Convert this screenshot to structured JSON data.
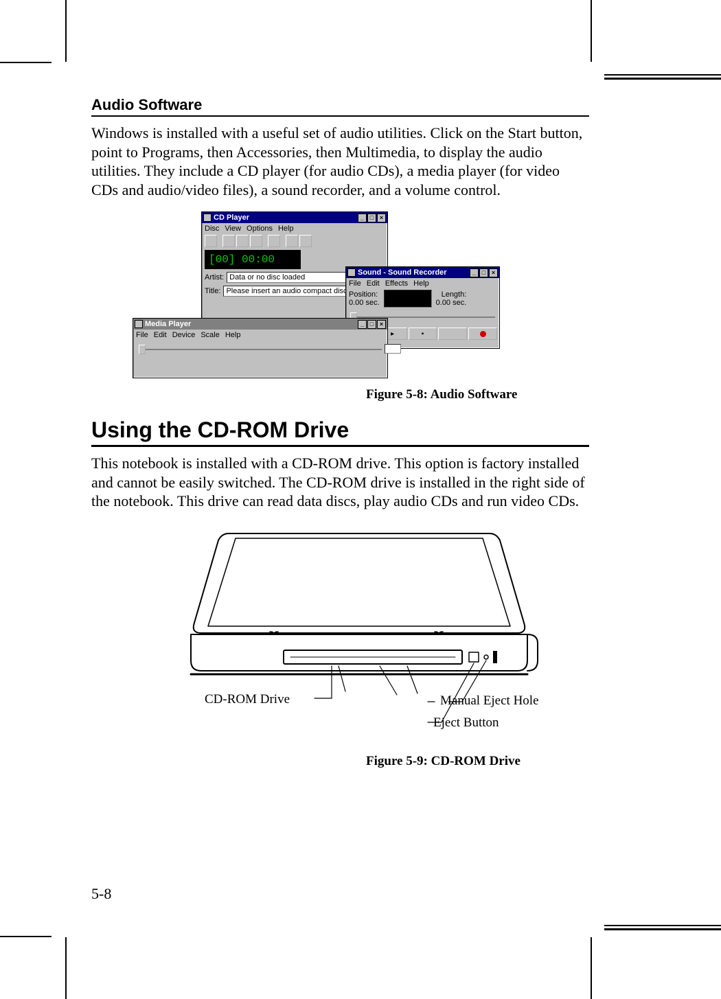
{
  "section_label": "Audio Software",
  "para1": "Windows is installed with a useful set of audio utilities.  Click on the Start button, point to Programs, then Accessories, then Multimedia, to display the audio utilities. They include a CD player (for audio CDs), a media player (for video CDs and audio/video files), a sound recorder, and a volume control.",
  "figure58_caption": "Figure 5-8: Audio Software",
  "heading_cdrom": "Using the CD-ROM Drive",
  "para2": "This notebook is installed with a CD-ROM drive. This option is factory installed and cannot be easily switched. The CD-ROM drive is installed in the right side of the notebook. This drive can read data discs, play audio CDs and run video CDs.",
  "figure59_caption": "Figure 5-9: CD-ROM Drive",
  "page_number": "5-8",
  "callouts": {
    "cdrom": "CD-ROM Drive",
    "manual_eject": "Manual Eject Hole",
    "eject_button": "Eject Button"
  },
  "cdplayer": {
    "title": "CD Player",
    "menus": [
      "Disc",
      "View",
      "Options",
      "Help"
    ],
    "display": "[00] 00:00",
    "artist_label": "Artist:",
    "artist_value": "Data or no disc loaded",
    "title_label": "Title:",
    "title_value": "Please insert an audio compact disc"
  },
  "soundrec": {
    "title": "Sound - Sound Recorder",
    "menus": [
      "File",
      "Edit",
      "Effects",
      "Help"
    ],
    "position_label": "Position:",
    "position_value": "0.00 sec.",
    "length_label": "Length:",
    "length_value": "0.00 sec."
  },
  "mediaplayer": {
    "title": "Media Player",
    "menus": [
      "File",
      "Edit",
      "Device",
      "Scale",
      "Help"
    ]
  }
}
